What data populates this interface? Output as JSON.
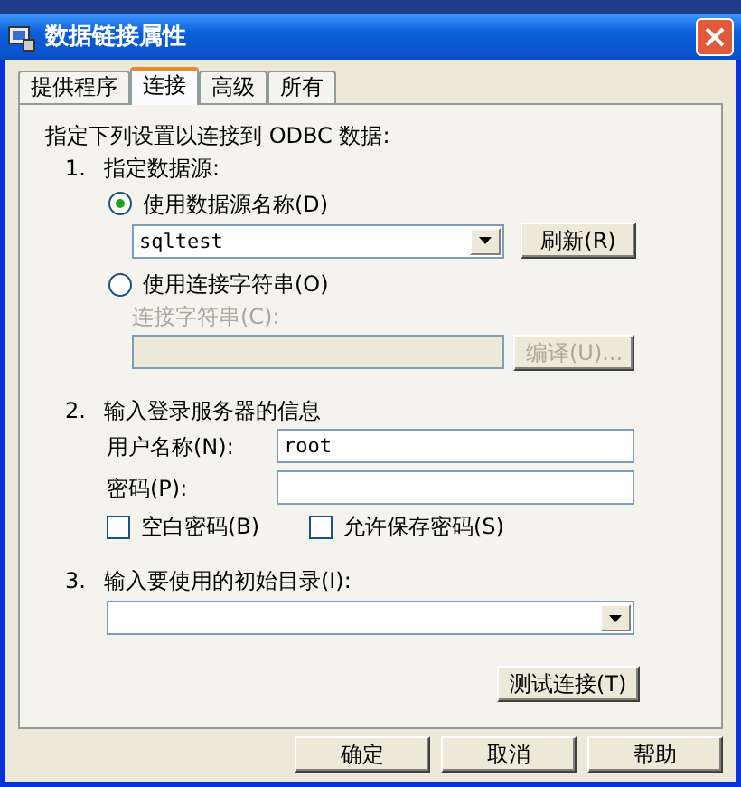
{
  "window": {
    "title": "数据链接属性"
  },
  "tabs": [
    {
      "label": "提供程序",
      "selected": false
    },
    {
      "label": "连接",
      "selected": true
    },
    {
      "label": "高级",
      "selected": false
    },
    {
      "label": "所有",
      "selected": false
    }
  ],
  "intro": "指定下列设置以连接到 ODBC 数据:",
  "step1": {
    "number": "1.",
    "heading": "指定数据源:",
    "options": [
      {
        "label": "使用数据源名称(D)",
        "selected": true
      },
      {
        "label": "使用连接字符串(O)",
        "selected": false
      }
    ],
    "dsn_field": {
      "value": "sqltest"
    },
    "refresh_button": "刷新(R)",
    "conn_string_label": {
      "text": "连接字符串(C):",
      "disabled": true
    },
    "conn_string_field": {
      "disabled": true
    },
    "compile_button": {
      "label": "编译(U)...",
      "disabled": true
    }
  },
  "step2": {
    "number": "2.",
    "heading": "输入登录服务器的信息",
    "username_label": "用户名称(N):",
    "username_field": {
      "value": "root"
    },
    "password_label": "密码(P):",
    "checkboxes": [
      {
        "label": "空白密码(B)",
        "checked": false
      },
      {
        "label": "允许保存密码(S)",
        "checked": false
      }
    ]
  },
  "step3": {
    "number": "3.",
    "heading": "输入要使用的初始目录(I):"
  },
  "test_button": "测试连接(T)",
  "buttons": [
    "确定",
    "取消",
    "帮助"
  ]
}
